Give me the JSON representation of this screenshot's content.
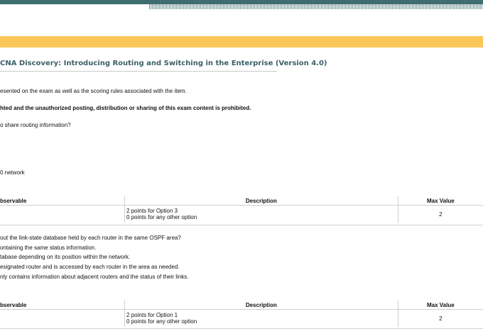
{
  "page": {
    "title": "CNA Discovery: Introducing Routing and Switching in the Enterprise (Version 4.0)",
    "intro_line": "esented on the exam as well as the scoring rules associated with the item.",
    "copyright_line": "hted and the unauthorized posting, distribution or sharing of this exam content is prohibited.",
    "question1_fragment": "o share routing information?",
    "question1_option_fragment": "0 network",
    "question2_fragment": "out the link-state database held by each router in the same OSPF area?",
    "question2_options": [
      "ontaining the same status information.",
      "tabase depending on its position within the network.",
      "esignated router and is accessed by each router in the area as needed.",
      "nly contains information about adjacent routers and the status of their links."
    ]
  },
  "tables": [
    {
      "headers": [
        "bservable",
        "Description",
        "Max Value"
      ],
      "row": {
        "observable": "",
        "description_lines": [
          "2 points for Option 3",
          "0 points for any other option"
        ],
        "max_value": "2"
      }
    },
    {
      "headers": [
        "bservable",
        "Description",
        "Max Value"
      ],
      "row": {
        "observable": "",
        "description_lines": [
          "2 points for Option 1",
          "0 points for any other option"
        ],
        "max_value": "2"
      }
    }
  ],
  "colors": {
    "header_bar": "#3e6e70",
    "accent_bar": "#fbc65a",
    "title_color": "#3c5f68"
  }
}
